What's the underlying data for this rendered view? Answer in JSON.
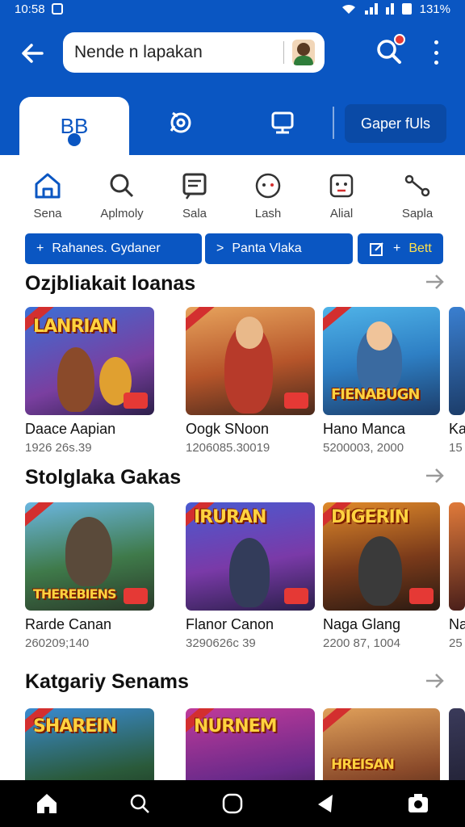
{
  "status": {
    "time": "10:58",
    "battery": "131%"
  },
  "search": {
    "value": "Nende n lapakan"
  },
  "tabs": {
    "active": "BB",
    "pill": "Gaper fUls"
  },
  "categories": [
    {
      "label": "Sena",
      "icon": "home-icon"
    },
    {
      "label": "Aplmoly",
      "icon": "search-icon"
    },
    {
      "label": "Sala",
      "icon": "document-icon"
    },
    {
      "label": "Lash",
      "icon": "face-icon"
    },
    {
      "label": "Alial",
      "icon": "robot-icon"
    },
    {
      "label": "Sapla",
      "icon": "nodes-icon"
    }
  ],
  "chips": [
    {
      "prefix": "+",
      "label": "Rahanes. Gydaner"
    },
    {
      "prefix": ">",
      "label": "Panta Vlaka"
    },
    {
      "prefix": "+",
      "label": "Bett"
    }
  ],
  "sections": [
    {
      "title": "Ozjbliakait loanas",
      "cards": [
        {
          "logo": "LANRIAN",
          "name": "Daace Aapian",
          "meta": "1926 26s.39"
        },
        {
          "logo": "",
          "name": "Oogk SNoon",
          "meta": "1206085.30019"
        },
        {
          "logo": "FIENABUGN",
          "name": "Hano Manca",
          "meta": "5200003, 2000"
        },
        {
          "logo": "",
          "name": "Ka",
          "meta": "15"
        }
      ]
    },
    {
      "title": "Stolglaka Gakas",
      "cards": [
        {
          "logo": "THEREBIENS",
          "name": "Rarde Canan",
          "meta": "260209;140"
        },
        {
          "logo": "IRURAN",
          "name": "Flanor Canon",
          "meta": "3290626c 39"
        },
        {
          "logo": "DIGERIN",
          "name": "Naga Glang",
          "meta": "2200 87, 1004"
        },
        {
          "logo": "",
          "name": "Na",
          "meta": "25"
        }
      ]
    },
    {
      "title": "Katgariy Senams",
      "cards": [
        {
          "logo": "SHAREIN",
          "name": "",
          "meta": ""
        },
        {
          "logo": "NURNEM",
          "name": "",
          "meta": ""
        },
        {
          "logo": "HREISAN",
          "name": "",
          "meta": ""
        },
        {
          "logo": "",
          "name": "",
          "meta": ""
        }
      ]
    }
  ],
  "colors": {
    "primary": "#0a56c2",
    "primary_dark": "#0a4aa6",
    "navbar": "#000000"
  }
}
